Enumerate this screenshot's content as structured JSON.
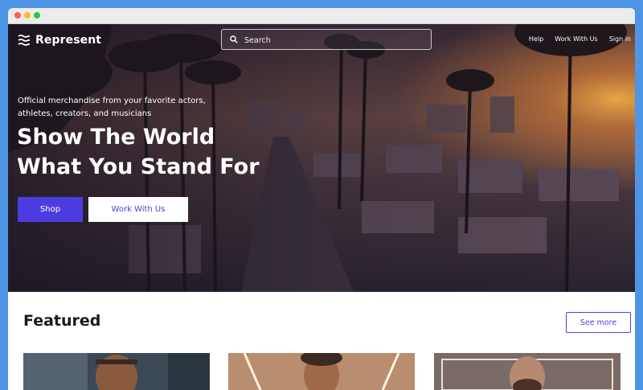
{
  "brand": {
    "name": "Represent"
  },
  "search": {
    "placeholder": "Search"
  },
  "nav": {
    "items": [
      "Help",
      "Work With Us",
      "Sign in"
    ]
  },
  "hero": {
    "tagline": "Official merchandise from your favorite actors, athletes, creators, and musicians",
    "headline_line1": "Show The World",
    "headline_line2": "What You Stand For",
    "primary_button": "Shop",
    "secondary_button": "Work With Us"
  },
  "featured": {
    "title": "Featured",
    "see_more": "See more"
  },
  "colors": {
    "accent": "#4d3de0",
    "page_background": "#4f95e6"
  }
}
